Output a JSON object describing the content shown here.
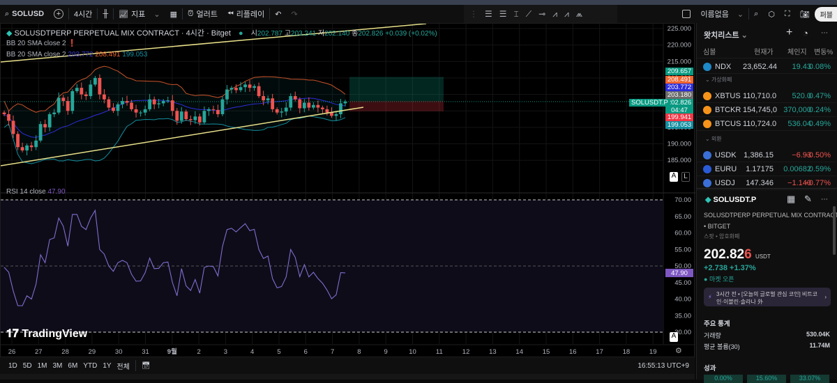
{
  "toolbar": {
    "symbol": "SOLUSD",
    "interval": "4시간",
    "indicators": "지표",
    "alert": "얼러트",
    "replay": "리플레이",
    "layout_name": "이름없음",
    "publish": "퍼블"
  },
  "legend": {
    "title": "SOLUSDTPERP PERPETUAL MIX CONTRACT · 4시간 · Bitget",
    "o_label": "시",
    "o": "202.787",
    "h_label": "고",
    "h": "203.241",
    "l_label": "저",
    "l": "202.140",
    "c_label": "종",
    "c": "202.826",
    "change": "+0.039 (+0.02%)",
    "bb1": "BB 20 SMA close 2",
    "bb2": "BB 20 SMA close 2",
    "bb_basis": "203.772",
    "bb_upper": "208.491",
    "bb_lower": "199.053",
    "rsi": "RSI 14 close",
    "rsi_val": "47.90"
  },
  "price_axis": {
    "ticks": [
      "225.000",
      "220.000",
      "215.000",
      "210.000",
      "205.000",
      "200.000",
      "195.000",
      "190.000",
      "185.000"
    ],
    "badges": [
      {
        "v": "209.657",
        "c": "#089981"
      },
      {
        "v": "208.491",
        "c": "#f0652f"
      },
      {
        "v": "203.772",
        "c": "#2d2ddc"
      },
      {
        "v": "203.180",
        "c": "#6b6b6b"
      },
      {
        "v": "202.826",
        "c": "#089981"
      },
      {
        "v": "04:47",
        "c": "#089981"
      },
      {
        "v": "199.941",
        "c": "#f23645"
      },
      {
        "v": "199.053",
        "c": "#138ea0"
      }
    ],
    "symbol_tag": "SOLUSDT.P",
    "auto": "A",
    "log": "L"
  },
  "rsi_axis": {
    "ticks": [
      "70.00",
      "65.00",
      "60.00",
      "55.00",
      "50.00",
      "45.00",
      "40.00",
      "35.00",
      "30.00"
    ],
    "current": "47.90"
  },
  "time_axis": [
    "26",
    "27",
    "28",
    "29",
    "30",
    "31",
    "9월",
    "2",
    "3",
    "4",
    "5",
    "6",
    "7",
    "8",
    "9",
    "10",
    "11",
    "12",
    "13",
    "14",
    "15",
    "16",
    "17",
    "18",
    "19"
  ],
  "bottombar": {
    "ranges": [
      "1D",
      "5D",
      "1M",
      "3M",
      "6M",
      "YTD",
      "1Y",
      "전체"
    ],
    "clock": "16:55:13 UTC+9"
  },
  "logo": "TradingView",
  "chart_data": {
    "type": "candlestick",
    "price_range": [
      183,
      227
    ],
    "closes": [
      199,
      197,
      193,
      189,
      188,
      189.5,
      189,
      191,
      196,
      195,
      199,
      199.5,
      204,
      203,
      200,
      206,
      207,
      205,
      204.5,
      208,
      210,
      205,
      203.5,
      201,
      200,
      202,
      203,
      202.5,
      200.5,
      199.5,
      199.5,
      200.5,
      203.5,
      202,
      202.3,
      203,
      203.2,
      200,
      197,
      199.8,
      197.5,
      197.2,
      198.3,
      196.5,
      200,
      200.5,
      200.3,
      199,
      203.5,
      206.5,
      207,
      206.3,
      207.2,
      208,
      207,
      207.5,
      204.5,
      203.2,
      203.8,
      200.5,
      199.5,
      199.8,
      201,
      204.5,
      203.5,
      200.8,
      202.5,
      201,
      201.8,
      201,
      200.5,
      199.5,
      198.5,
      199,
      202.3,
      202.8
    ],
    "rsi": [
      49.6,
      48.1,
      42.4,
      38,
      38,
      41,
      40,
      44.5,
      53.4,
      51,
      58,
      58.5,
      64.5,
      62,
      56,
      65.6,
      65.6,
      62,
      61,
      64.5,
      66.8,
      55,
      53.6,
      50,
      48.4,
      51,
      51.7,
      51,
      47.5,
      45.4,
      45.5,
      48,
      52.4,
      49.2,
      49.3,
      51,
      51.2,
      45,
      41,
      49.2,
      44,
      42.6,
      45.9,
      41.8,
      49.6,
      50,
      49.8,
      47,
      55.9,
      61,
      61.4,
      60.3,
      61.6,
      62.8,
      60.7,
      61.1,
      55,
      52.3,
      53,
      46.2,
      43.4,
      43.8,
      46.7,
      55,
      52.6,
      46.8,
      50.4,
      46.7,
      48.1,
      46.2,
      44.8,
      42.7,
      40.1,
      41.3,
      48,
      47.9
    ],
    "rsi_range": [
      30,
      70
    ]
  },
  "watchlist": {
    "title": "왓치리스트",
    "cols": [
      "심볼",
      "현재가",
      "체인지",
      "변동%"
    ],
    "rows": [
      {
        "sym": "NDX",
        "last": "23,652.44",
        "chg": "19.43",
        "pct": "0.08%",
        "dir": "up",
        "color": "#1e88c8"
      }
    ],
    "groups": [
      {
        "name": "가상화폐",
        "rows": [
          {
            "sym": "XBTUS",
            "last": "110,710.0",
            "chg": "520.0",
            "pct": "0.47%",
            "dir": "up",
            "color": "#f7931a"
          },
          {
            "sym": "BTCKR",
            "last": "154,745,0",
            "chg": "370,000",
            "pct": "0.24%",
            "dir": "up",
            "color": "#f7931a"
          },
          {
            "sym": "BTCUS",
            "last": "110,724.0",
            "chg": "536.04",
            "pct": "0.49%",
            "dir": "up",
            "color": "#f7931a"
          }
        ]
      },
      {
        "name": "외환",
        "rows": [
          {
            "sym": "USDK",
            "last": "1,386.15",
            "chg": "−6.93",
            "pct": "−0.50%",
            "dir": "dn",
            "color": "#3b6fd8"
          },
          {
            "sym": "EURU",
            "last": "1.17175",
            "chg": "0.00682",
            "pct": "0.59%",
            "dir": "up",
            "color": "#2a5bd7"
          },
          {
            "sym": "USDJ",
            "last": "147.346",
            "chg": "−1.140",
            "pct": "−0.77%",
            "dir": "dn",
            "color": "#3b6fd8"
          }
        ]
      }
    ]
  },
  "detail": {
    "symbol": "SOLUSDT.P",
    "name": "SOLUSDTPERP PERPETUAL MIX CONTRACT",
    "exchange": "• BITGET",
    "type": "스팟 • 암호화폐",
    "price_main": "202.82",
    "price_last": "6",
    "currency": "USDT",
    "change": "+2.738",
    "change_pct": "+1.37%",
    "market": "마켓 오픈",
    "news": "3시간 전 • [오늘의 글로벌 관심 코인] 비트코인·이블린·솔라나 外",
    "stats_title": "주요 통계",
    "volume_label": "거래량",
    "volume": "530.04K",
    "avgvol_label": "평균 볼륨(30)",
    "avgvol": "11.74M",
    "perf_title": "성과",
    "perf": [
      "0.00%",
      "15.60%",
      "33.07%"
    ]
  },
  "colors": {
    "up": "#26a69a",
    "down": "#ef5350",
    "trend": "#e8e08a"
  }
}
